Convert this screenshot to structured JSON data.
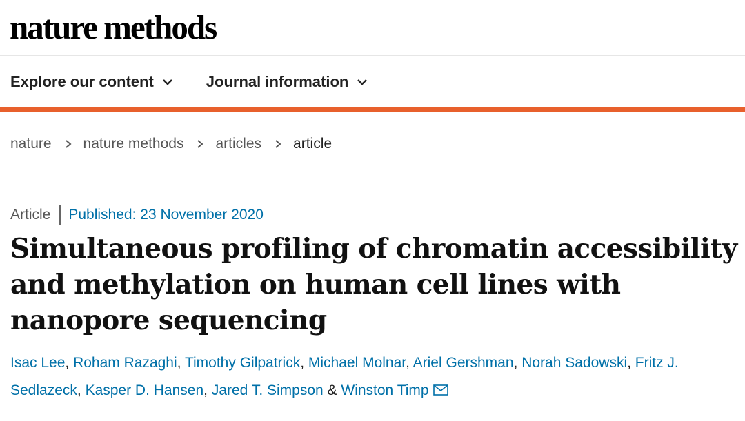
{
  "header": {
    "logo": "nature methods"
  },
  "nav": {
    "items": [
      {
        "label": "Explore our content"
      },
      {
        "label": "Journal information"
      }
    ]
  },
  "breadcrumb": [
    "nature",
    "nature methods",
    "articles",
    "article"
  ],
  "article": {
    "type": "Article",
    "published": "Published: 23 November 2020",
    "title": "Simultaneous profiling of chromatin accessibility and methylation on human cell lines with nanopore sequencing",
    "authors": [
      "Isac Lee",
      "Roham Razaghi",
      "Timothy Gilpatrick",
      "Michael Molnar",
      "Ariel Gershman",
      "Norah Sadowski",
      "Fritz J. Sedlazeck",
      "Kasper D. Hansen",
      "Jared T. Simpson",
      "Winston Timp"
    ],
    "author_separator": ", ",
    "author_final_separator": " & "
  },
  "colors": {
    "accent": "#e8602c",
    "link": "#0070a8"
  },
  "icons": {
    "nav_dropdown": "chevron-down-icon",
    "breadcrumb_sep": "chevron-right-icon",
    "email": "envelope-icon"
  }
}
